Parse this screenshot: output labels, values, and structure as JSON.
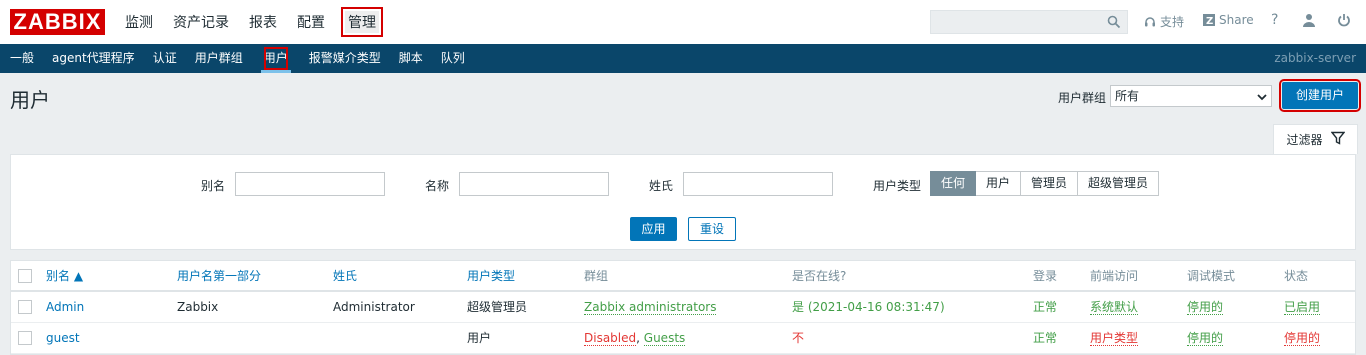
{
  "header": {
    "logo": "ZABBIX",
    "menu": [
      "监测",
      "资产记录",
      "报表",
      "配置",
      "管理"
    ],
    "support": "支持",
    "share": "Share",
    "help": "?"
  },
  "submenu": {
    "items": [
      "一般",
      "agent代理程序",
      "认证",
      "用户群组",
      "用户",
      "报警媒介类型",
      "脚本",
      "队列"
    ],
    "server": "zabbix-server"
  },
  "page": {
    "title": "用户",
    "group_label": "用户群组",
    "group_value": "所有",
    "create_button": "创建用户",
    "filter_tab": "过滤器"
  },
  "filter": {
    "alias_label": "别名",
    "name_label": "名称",
    "surname_label": "姓氏",
    "type_label": "用户类型",
    "type_options": [
      "任何",
      "用户",
      "管理员",
      "超级管理员"
    ],
    "apply": "应用",
    "reset": "重设"
  },
  "table": {
    "headers": [
      "别名 ▲",
      "用户名第一部分",
      "姓氏",
      "用户类型",
      "群组",
      "是否在线?",
      "登录",
      "前端访问",
      "调试模式",
      "状态"
    ],
    "rows": [
      {
        "alias": "Admin",
        "name": "Zabbix",
        "surname": "Administrator",
        "type": "超级管理员",
        "groups": "Zabbix administrators",
        "online": "是 (2021-04-16 08:31:47)",
        "login": "正常",
        "frontend": "系统默认",
        "debug": "停用的",
        "status": "已启用"
      },
      {
        "alias": "guest",
        "name": "",
        "surname": "",
        "type": "用户",
        "group_a": "Disabled",
        "group_sep": ", ",
        "group_b": "Guests",
        "online": "不",
        "login": "正常",
        "frontend": "用户类型",
        "debug": "停用的",
        "status": "停用的"
      }
    ]
  },
  "colors": {
    "brand": "#d40000",
    "nav": "#0a466a",
    "primary": "#0275b8",
    "green": "#429e47",
    "red": "#e33734"
  }
}
